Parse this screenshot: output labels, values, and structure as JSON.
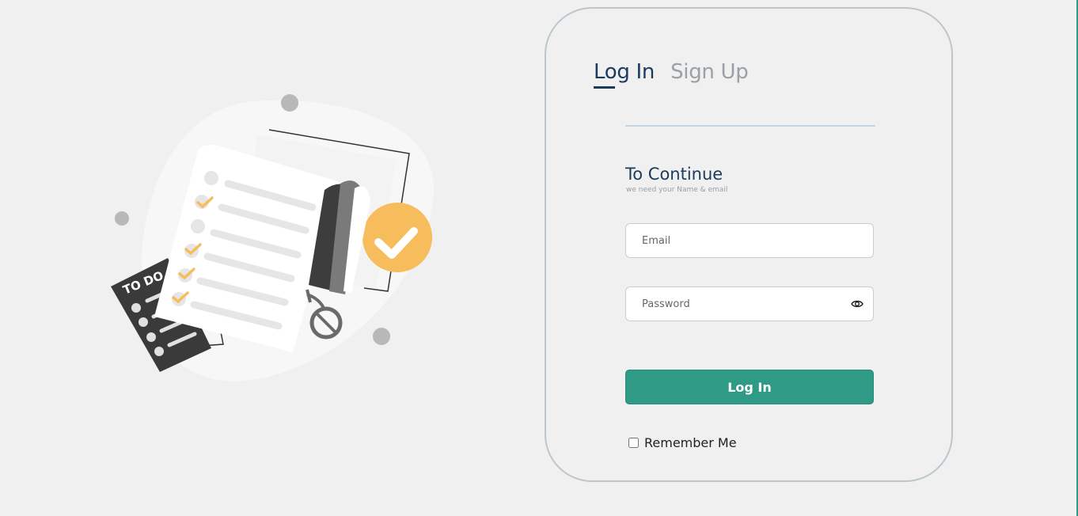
{
  "tabs": {
    "login": "Log In",
    "signup": "Sign Up"
  },
  "form": {
    "heading": "To Continue",
    "subheading": "we need your Name & email",
    "email_placeholder": "Email",
    "password_placeholder": "Password",
    "submit_label": "Log In",
    "remember_label": "Remember Me",
    "remember_checked": false
  },
  "illustration": {
    "badge_text": "TO DO",
    "icons": [
      "checklist-illustration",
      "check-badge-icon",
      "scissors-icon"
    ]
  },
  "colors": {
    "background": "#f0f0f0",
    "primary": "#2f9a86",
    "heading": "#1b3a5c",
    "muted": "#9aa0a6",
    "accent_yellow": "#f7bc5c"
  }
}
